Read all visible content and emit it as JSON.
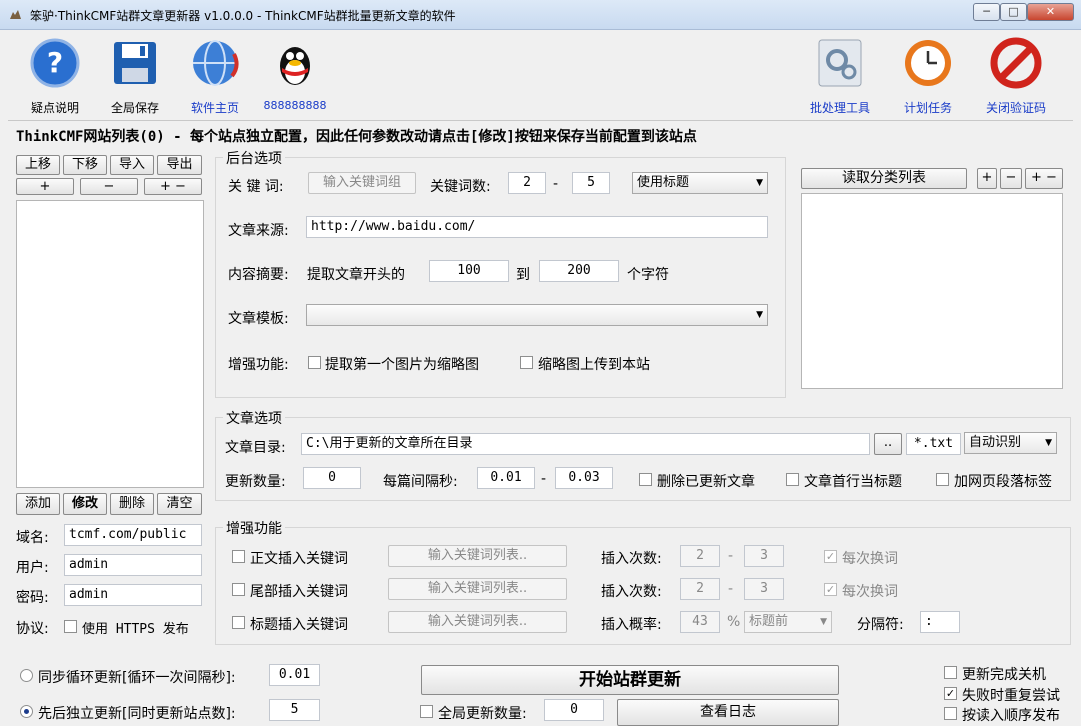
{
  "window": {
    "title": "笨驴·ThinkCMF站群文章更新器 v1.0.0.0 - ThinkCMF站群批量更新文章的软件",
    "min": "─",
    "max": "□",
    "close": "✕"
  },
  "toolbar": {
    "left": [
      {
        "label": "疑点说明",
        "icon": "help-icon"
      },
      {
        "label": "全局保存",
        "icon": "floppy-disk-icon"
      },
      {
        "label": "软件主页",
        "icon": "globe-icon"
      },
      {
        "label": "888888888",
        "icon": "qq-penguin-icon"
      }
    ],
    "right": [
      {
        "label": "批处理工具",
        "icon": "batch-tool-icon"
      },
      {
        "label": "计划任务",
        "icon": "clock-icon"
      },
      {
        "label": "关闭验证码",
        "icon": "no-symbol-icon"
      }
    ]
  },
  "header": "ThinkCMF网站列表(0) - 每个站点独立配置，因此任何参数改动请点击[修改]按钮来保存当前配置到该站点",
  "sitelist": {
    "buttons_top": [
      "上移",
      "下移",
      "导入",
      "导出"
    ],
    "buttons_mid": [
      "+",
      "−",
      "+ −"
    ],
    "buttons_bottom": [
      "添加",
      "修改",
      "删除",
      "清空"
    ],
    "domain_label": "域名:",
    "domain": "tcmf.com/public",
    "user_label": "用户:",
    "user": "admin",
    "pass_label": "密码:",
    "pass": "admin",
    "proto_label": "协议:",
    "https_label": "使用 HTTPS 发布"
  },
  "backend": {
    "title": "后台选项",
    "kw_label": "关 键 词:",
    "kw_btn": "输入关键词组",
    "kwcount_label": "关键词数:",
    "kw_min": "2",
    "kw_max": "5",
    "dash": "-",
    "title_mode": "使用标题",
    "source_label": "文章来源:",
    "source": "http://www.baidu.com/",
    "summary_label": "内容摘要:",
    "summary_pre": "提取文章开头的",
    "sum_from": "100",
    "sum_to_label": "到",
    "sum_to": "200",
    "sum_unit": "个字符",
    "template_label": "文章模板:",
    "template": "",
    "enhance_label": "增强功能:",
    "opt1": "提取第一个图片为缩略图",
    "opt2": "缩略图上传到本站"
  },
  "category": {
    "read_btn": "读取分类列表",
    "btn_add": "+",
    "btn_minus": "−",
    "btn_pm": "+ −"
  },
  "article": {
    "title": "文章选项",
    "dir_label": "文章目录:",
    "dir": "C:\\用于更新的文章所在目录",
    "browse": "..",
    "ext": "*.txt",
    "encoding": "自动识别",
    "count_label": "更新数量:",
    "count": "0",
    "interval_label": "每篇间隔秒:",
    "int_min": "0.01",
    "int_max": "0.03",
    "dash": "-",
    "opt_delete": "删除已更新文章",
    "opt_firstline": "文章首行当标题",
    "opt_para": "加网页段落标签"
  },
  "enhance": {
    "title": "增强功能",
    "rows": [
      {
        "label": "正文插入关键词",
        "btn": "输入关键词列表..",
        "n_label": "插入次数:",
        "a": "2",
        "b": "3",
        "chk": "每次换词"
      },
      {
        "label": "尾部插入关键词",
        "btn": "输入关键词列表..",
        "n_label": "插入次数:",
        "a": "2",
        "b": "3",
        "chk": "每次换词"
      }
    ],
    "row3": {
      "label": "标题插入关键词",
      "btn": "输入关键词列表..",
      "p_label": "插入概率:",
      "p": "43",
      "pct": "%",
      "pos": "标题前",
      "sep_label": "分隔符:",
      "sep": ":"
    }
  },
  "bottom": {
    "sync_label": "同步循环更新[循环一次间隔秒]:",
    "sync_val": "0.01",
    "seq_label": "先后独立更新[同时更新站点数]:",
    "seq_val": "5",
    "start": "开始站群更新",
    "global_label": "全局更新数量:",
    "global_val": "0",
    "log": "查看日志",
    "opt_shutdown": "更新完成关机",
    "opt_retry": "失败时重复尝试",
    "opt_order": "按读入顺序发布"
  }
}
